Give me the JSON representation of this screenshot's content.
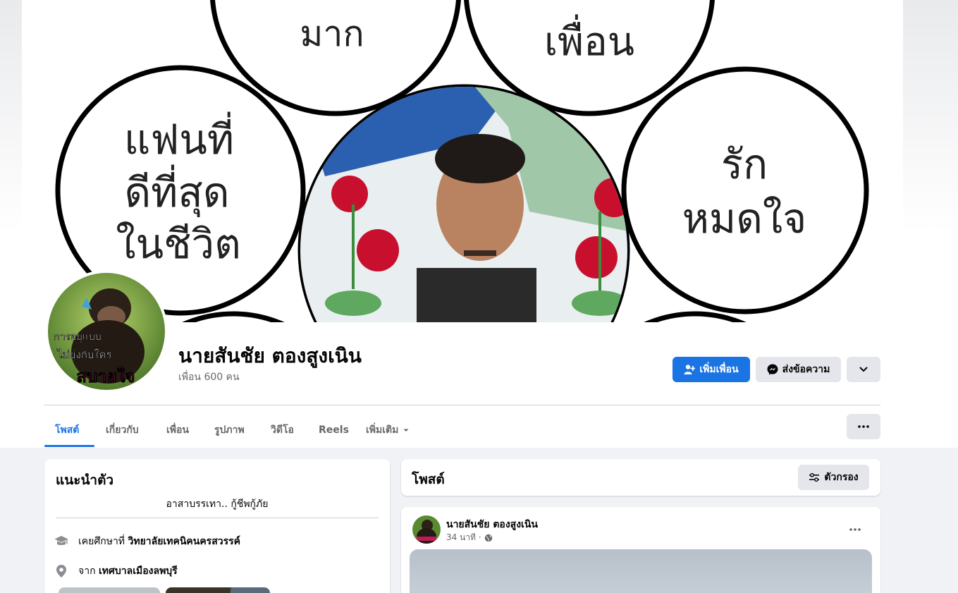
{
  "cover": {
    "bubbles": [
      "ประเสริฐ มาก",
      "กำลังใจ เพื่อน",
      "แฟนที่ ดีที่สุด ในชีวิต",
      "รัก หมดใจ"
    ]
  },
  "avatar": {
    "caption_1": "การอยู่แบบ",
    "caption_2": "ไม่ยุ่งกับใคร",
    "caption_3": "สบายใจ"
  },
  "profile": {
    "name": "นายสันชัย ตองสูงเนิน",
    "friends": "เพื่อน 600 คน"
  },
  "actions": {
    "add_friend": "เพิ่มเพื่อน",
    "message": "ส่งข้อความ"
  },
  "tabs": [
    {
      "label": "โพสต์"
    },
    {
      "label": "เกี่ยวกับ"
    },
    {
      "label": "เพื่อน"
    },
    {
      "label": "รูปภาพ"
    },
    {
      "label": "วิดีโอ"
    },
    {
      "label": "Reels"
    },
    {
      "label": "เพิ่มเติม"
    }
  ],
  "intro": {
    "title": "แนะนำตัว",
    "bio": "อาสาบรรเทา.. กู้ชีพกู้ภัย",
    "education_prefix": "เคยศึกษาที่",
    "education_place": "วิทยาลัยเทคนิคนครสวรรค์",
    "from_prefix": "จาก",
    "from_place": "เทศบาลเมืองลพบุรี"
  },
  "posts": {
    "title": "โพสต์",
    "filter_label": "ตัวกรอง",
    "post": {
      "author": "นายสันชัย ตองสูงเนิน",
      "time": "34 นาที ·"
    }
  },
  "colors": {
    "accent": "#1b74e4",
    "button_gray": "#e4e6eb",
    "secondary_text": "#65676b"
  }
}
